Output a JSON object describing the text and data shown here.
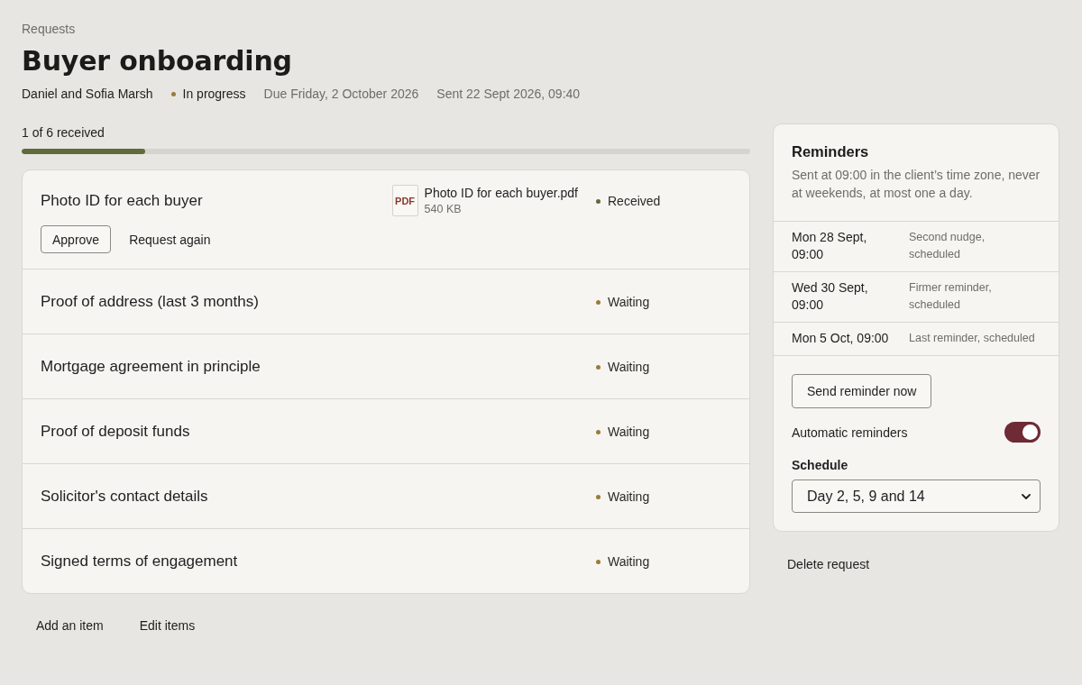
{
  "breadcrumb": "Requests",
  "title": "Buyer onboarding",
  "meta": {
    "client": "Daniel and Sofia Marsh",
    "status": {
      "label": "In progress",
      "color": "#9a7b3c"
    },
    "due": "Due Friday, 2 October 2026",
    "sent": "Sent 22 Sept 2026, 09:40"
  },
  "progress": {
    "label": "1 of 6 received",
    "level": 0.17
  },
  "items": [
    {
      "title": "Photo ID for each buyer",
      "file": {
        "type_label": "PDF",
        "name": "Photo ID for each buyer.pdf",
        "size": "540 KB"
      },
      "status": {
        "label": "Received",
        "color": "#5e6b3a"
      },
      "actions": [
        {
          "label": "Approve",
          "kind": "outline"
        },
        {
          "label": "Request again",
          "kind": "text"
        }
      ]
    },
    {
      "title": "Proof of address (last 3 months)",
      "status": {
        "label": "Waiting",
        "color": "#9a7b3c"
      }
    },
    {
      "title": "Mortgage agreement in principle",
      "status": {
        "label": "Waiting",
        "color": "#9a7b3c"
      }
    },
    {
      "title": "Proof of deposit funds",
      "status": {
        "label": "Waiting",
        "color": "#9a7b3c"
      }
    },
    {
      "title": "Solicitor's contact details",
      "status": {
        "label": "Waiting",
        "color": "#9a7b3c"
      }
    },
    {
      "title": "Signed terms of engagement",
      "status": {
        "label": "Waiting",
        "color": "#9a7b3c"
      }
    }
  ],
  "item_actions": [
    "Add an item",
    "Edit items"
  ],
  "reminders": {
    "title": "Reminders",
    "description": "Sent at 09:00 in the client’s time zone, never at weekends, at most one a day.",
    "schedule": [
      {
        "date": "Mon 28 Sept, 09:00",
        "note": "Second nudge, scheduled"
      },
      {
        "date": "Wed 30 Sept, 09:00",
        "note": "Firmer reminder, scheduled"
      },
      {
        "date": "Mon 5 Oct, 09:00",
        "note": "Last reminder, scheduled"
      }
    ],
    "send_button": "Send reminder now",
    "auto": {
      "label": "Automatic reminders",
      "on": true
    },
    "schedule_select": {
      "label": "Schedule",
      "value": "Day 2, 5, 9 and 14"
    }
  },
  "delete_button": "Delete request"
}
